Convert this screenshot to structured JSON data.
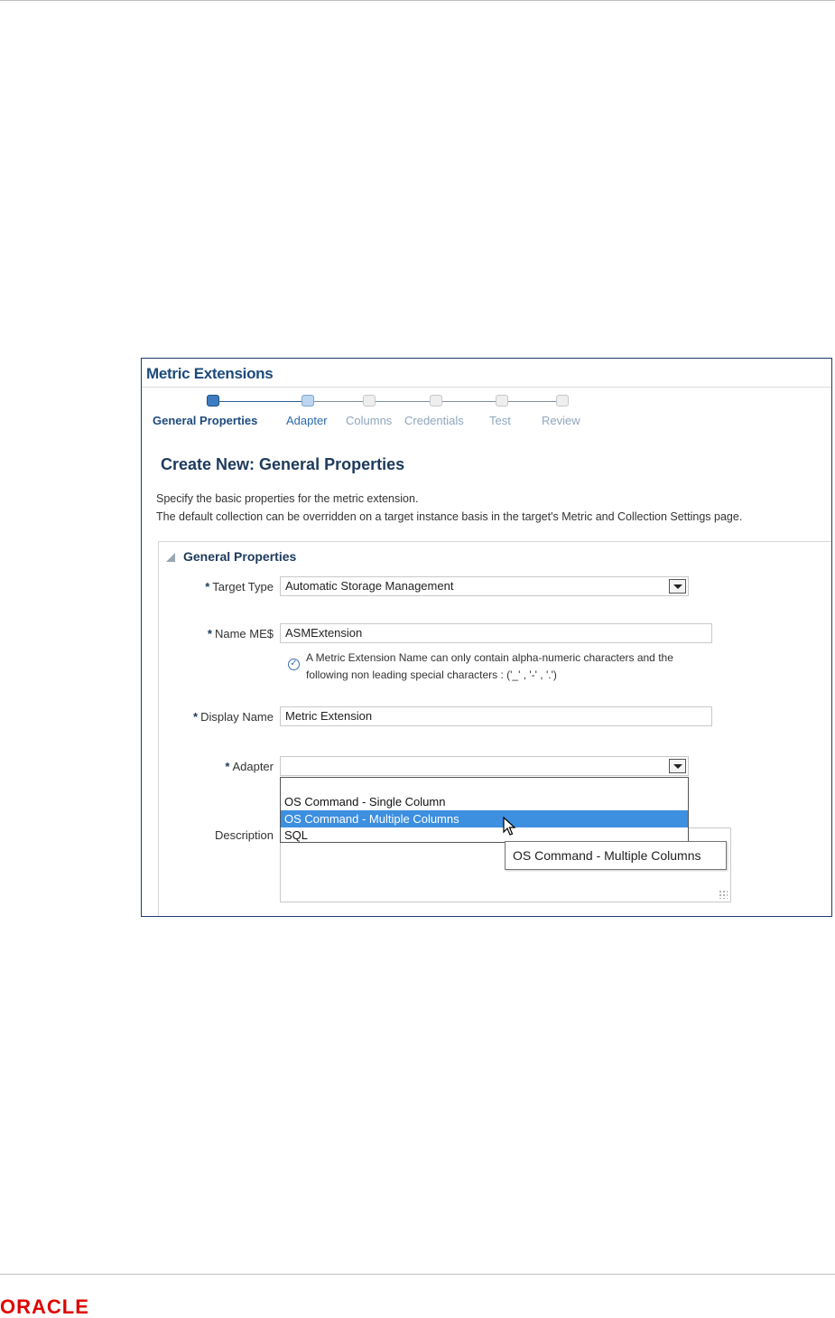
{
  "brand": {
    "logo_text": "ORACLE",
    "color": "#e00000"
  },
  "app": {
    "title": "Metric Extensions"
  },
  "train": {
    "steps": [
      {
        "label": "General Properties",
        "state": "current"
      },
      {
        "label": "Adapter",
        "state": "next"
      },
      {
        "label": "Columns",
        "state": "future"
      },
      {
        "label": "Credentials",
        "state": "future"
      },
      {
        "label": "Test",
        "state": "future"
      },
      {
        "label": "Review",
        "state": "future"
      }
    ]
  },
  "page": {
    "heading": "Create New: General Properties",
    "instructions": [
      "Specify the basic properties for the metric extension.",
      "The default collection can be overridden on a target instance basis in the target's Metric and Collection Settings page."
    ]
  },
  "section": {
    "title": "General Properties",
    "fields": {
      "target_type": {
        "label": "Target Type",
        "required_mark": "*",
        "value": "Automatic Storage Management"
      },
      "name": {
        "label": "Name ME$",
        "required_mark": "*",
        "value": "ASMExtension",
        "hint": [
          "A Metric Extension Name can only contain alpha-numeric characters and the",
          "following non leading special characters : ('_' , '-' , '.')"
        ]
      },
      "display_name": {
        "label": "Display Name",
        "required_mark": "*",
        "value": "Metric Extension"
      },
      "adapter": {
        "label": "Adapter",
        "required_mark": "*",
        "value": "",
        "options": [
          "",
          "OS Command - Single Column",
          "OS Command - Multiple Columns",
          "SQL"
        ],
        "highlighted_option": "OS Command - Multiple Columns"
      },
      "description": {
        "label": "Description",
        "value": ""
      }
    }
  },
  "tooltip": {
    "text": "OS Command - Multiple Columns"
  },
  "colors": {
    "accent": "#1d4a7d",
    "selection": "#3d8fe0"
  }
}
